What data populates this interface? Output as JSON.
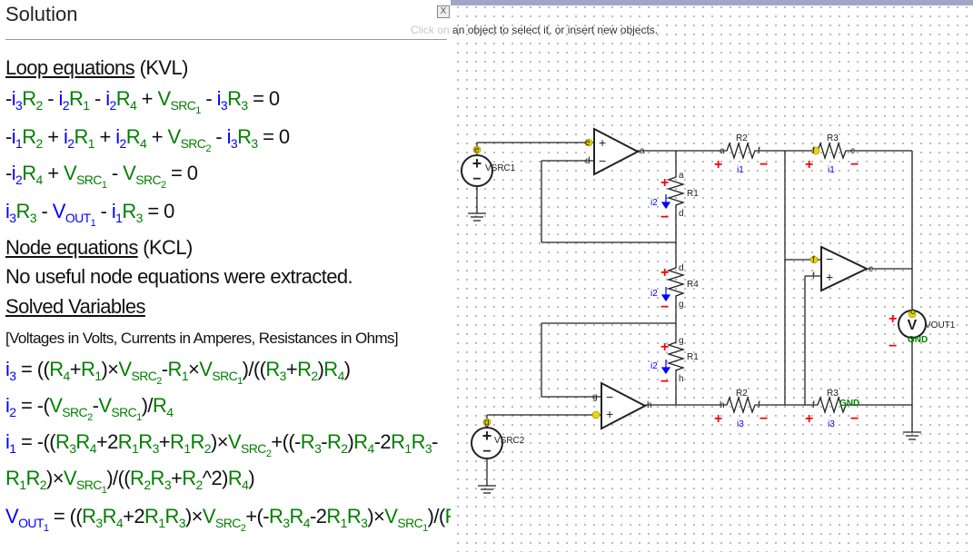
{
  "solution": {
    "title": "Solution",
    "close_label": "X",
    "loop_heading": "Loop equations",
    "loop_paren": " (KVL)",
    "node_heading": "Node equations",
    "node_paren": " (KCL)",
    "node_note": "No useful node equations were extracted.",
    "solved_heading": "Solved Variables",
    "units_note": "[Voltages in Volts, Currents in Amperes, Resistances in Ohms]"
  },
  "canvas": {
    "hint_faded": "Click on",
    "hint": " an object to select it, or insert new objects."
  },
  "schematic": {
    "labels": {
      "vsrc1": "VSRC1",
      "vsrc2": "VSRC2",
      "vout1": "VOUT1",
      "r1a": "R1",
      "r1b": "R1",
      "r2a": "R2",
      "r2b": "R2",
      "r3a": "R3",
      "r3b": "R3",
      "r4": "R4",
      "i1a": "i1",
      "i1b": "i1",
      "i2a": "i2",
      "i2b": "i2",
      "i2c": "i2",
      "i3a": "i3",
      "i3b": "i3",
      "gnd": "GND",
      "gnd2": "GND",
      "n_a1": "a",
      "n_a2": "a",
      "n_a3": "a",
      "n_c1": "c",
      "n_c2": "c",
      "n_c3": "c",
      "n_d1": "d",
      "n_d2": "d",
      "n_d3": "d",
      "n_f1": "f",
      "n_f2": "f",
      "n_f3": "f",
      "n_f4": "f",
      "n_f5": "f",
      "n_f6": "f",
      "n_g1": "g",
      "n_g2": "g",
      "n_g3": "g",
      "n_g4": "g",
      "n_h1": "h",
      "n_h2": "h",
      "n_h3": "h",
      "n_e1": "e",
      "n_e2": "e"
    },
    "colors": {
      "wire": "#222222",
      "label": "#222222",
      "current": "#0000ff",
      "plus": "#ff0000",
      "name": "#008000",
      "node_dot": "#e8d800"
    }
  }
}
